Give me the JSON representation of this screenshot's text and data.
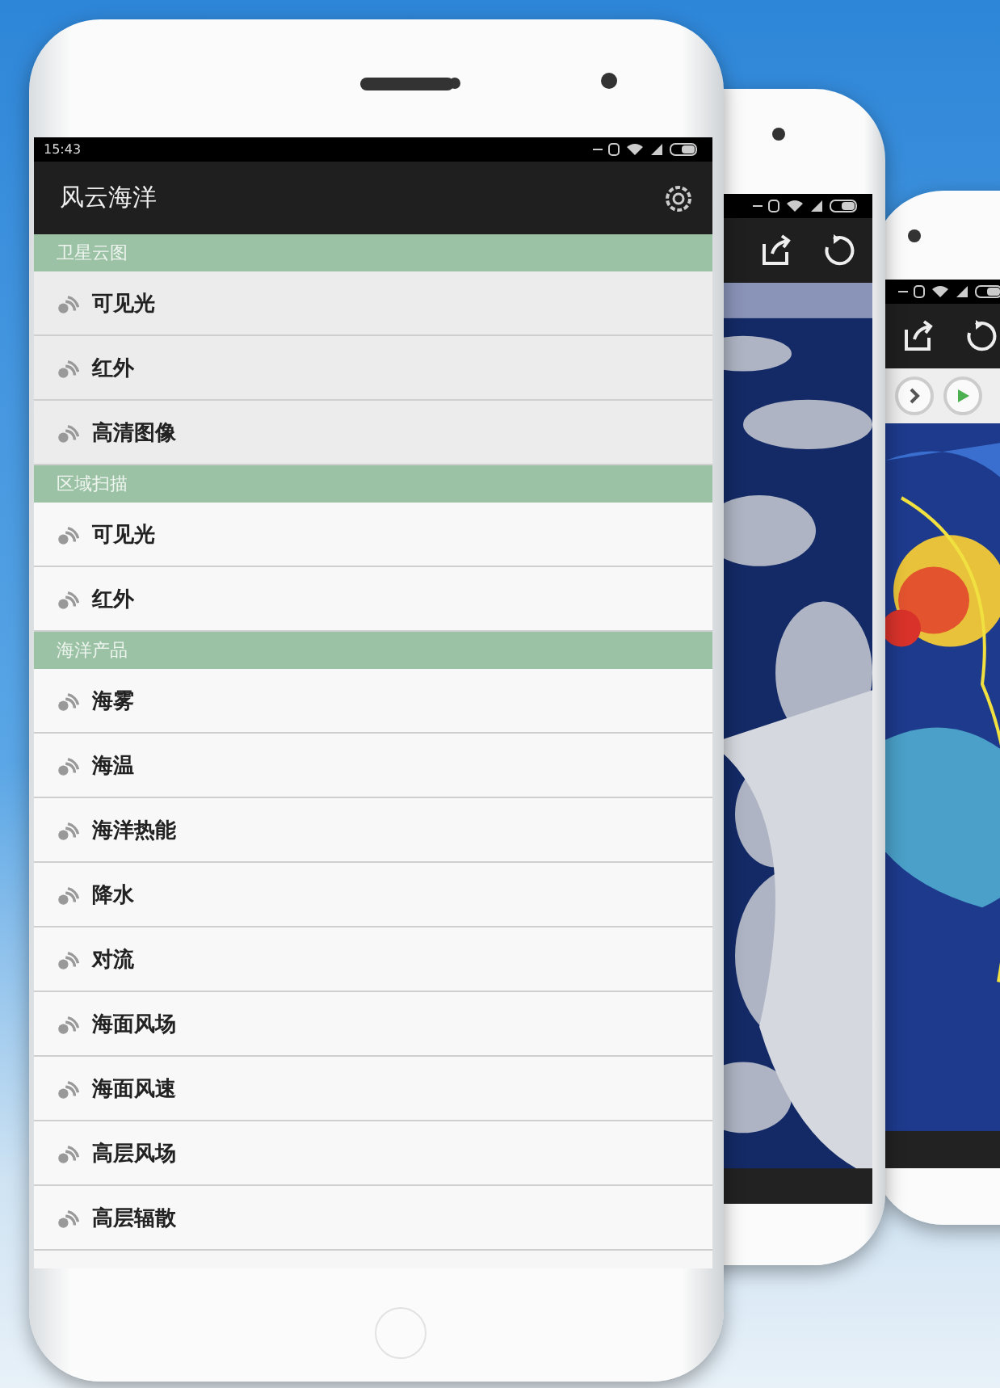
{
  "status_bar": {
    "time": "15:43"
  },
  "app_bar": {
    "title": "风云海洋"
  },
  "sections": [
    {
      "header": "卫星云图",
      "items": [
        "可见光",
        "红外",
        "高清图像"
      ]
    },
    {
      "header": "区域扫描",
      "items": [
        "可见光",
        "红外"
      ]
    },
    {
      "header": "海洋产品",
      "items": [
        "海雾",
        "海温",
        "海洋热能",
        "降水",
        "对流",
        "海面风场",
        "海面风速",
        "高层风场",
        "高层辐散"
      ]
    }
  ]
}
